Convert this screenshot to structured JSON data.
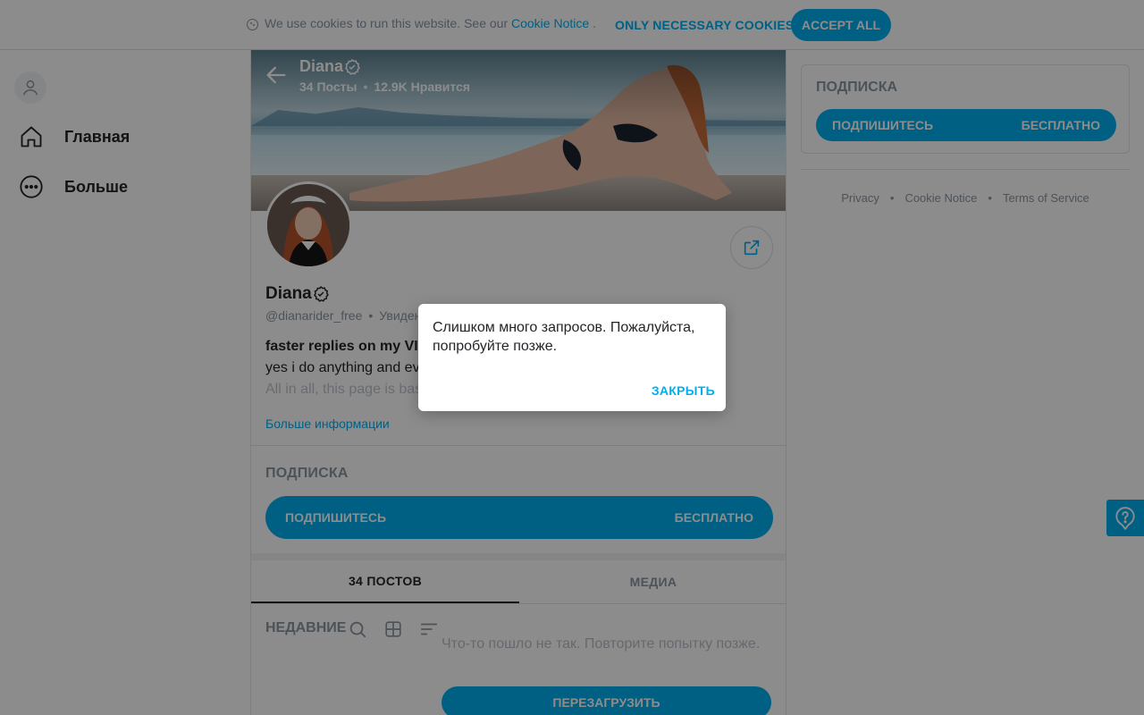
{
  "cookie_bar": {
    "text": "We use cookies to run this website. See our ",
    "link": "Cookie Notice",
    "after_link": " .",
    "necessary_label": "ONLY NECESSARY COOKIES",
    "accept_label": "ACCEPT ALL"
  },
  "nav": {
    "items": [
      {
        "label": "Главная",
        "icon": "home-icon"
      },
      {
        "label": "Больше",
        "icon": "more-icon"
      }
    ]
  },
  "profile": {
    "name": "Diana",
    "posts_stat": "34 Посты",
    "likes_stat": "12.9K Нравится",
    "handle": "@dianarider_free",
    "last_seen": "Увиден",
    "bio_line1": "faster replies on my VIP",
    "bio_line2": "yes i do anything and eve",
    "bio_line3": "All in all, this page is bas",
    "more_info": "Больше информации"
  },
  "subscription": {
    "title": "ПОДПИСКА",
    "button_left": "ПОДПИШИТЕСЬ",
    "button_right": "БЕСПЛАТНО"
  },
  "tabs": [
    {
      "label": "34 ПОСТОВ",
      "active": true
    },
    {
      "label": "МЕДИА",
      "active": false
    }
  ],
  "feed": {
    "recent_label": "НЕДАВНИЕ",
    "error_text": "Что-то пошло не так. Повторите попытку позже.",
    "reload_label": "ПЕРЕЗАГРУЗИТЬ"
  },
  "right": {
    "title": "ПОДПИСКА",
    "button_left": "ПОДПИШИТЕСЬ",
    "button_right": "БЕСПЛАТНО",
    "footer": [
      "Privacy",
      "Cookie Notice",
      "Terms of Service"
    ]
  },
  "dialog": {
    "message": "Слишком много запросов. Пожалуйста, попробуйте позже.",
    "close_label": "ЗАКРЫТЬ"
  },
  "colors": {
    "accent": "#00aff0",
    "text": "#242529",
    "muted": "#8a96a3",
    "overlay": "rgba(0,0,0,0.45)"
  }
}
